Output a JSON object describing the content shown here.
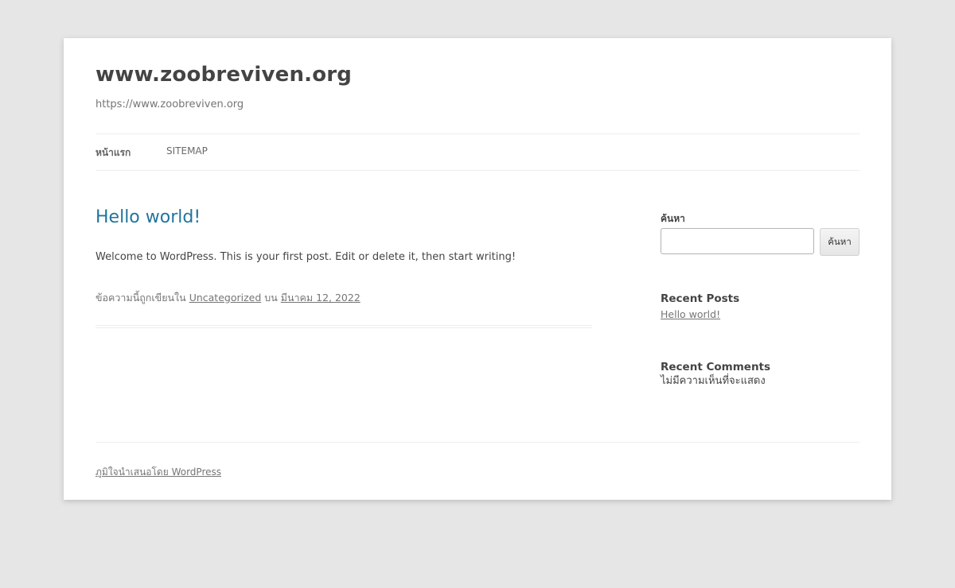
{
  "site": {
    "title": "www.zoobreviven.org",
    "description": "https://www.zoobreviven.org"
  },
  "nav": {
    "items": [
      {
        "label": "หน้าแรก",
        "current": true
      },
      {
        "label": "SITEMAP",
        "current": false
      }
    ]
  },
  "post": {
    "title": "Hello world!",
    "content": "Welcome to WordPress. This is your first post. Edit or delete it, then start writing!",
    "meta_prefix": "ข้อความนี้ถูกเขียนใน",
    "category": "Uncategorized",
    "meta_on": "บน",
    "date": "มีนาคม 12, 2022"
  },
  "sidebar": {
    "search": {
      "label": "ค้นหา",
      "value": "",
      "button_label": "ค้นหา"
    },
    "recent_posts": {
      "title": "Recent Posts",
      "items": [
        "Hello world!"
      ]
    },
    "recent_comments": {
      "title": "Recent Comments",
      "empty_text": "ไม่มีความเห็นที่จะแสดง"
    }
  },
  "footer": {
    "credit": "ภูมิใจนำเสนอโดย WordPress"
  },
  "colors": {
    "background": "#e6e6e6",
    "page": "#ffffff",
    "link_accent": "#21759b",
    "text": "#444444",
    "muted": "#757575"
  }
}
